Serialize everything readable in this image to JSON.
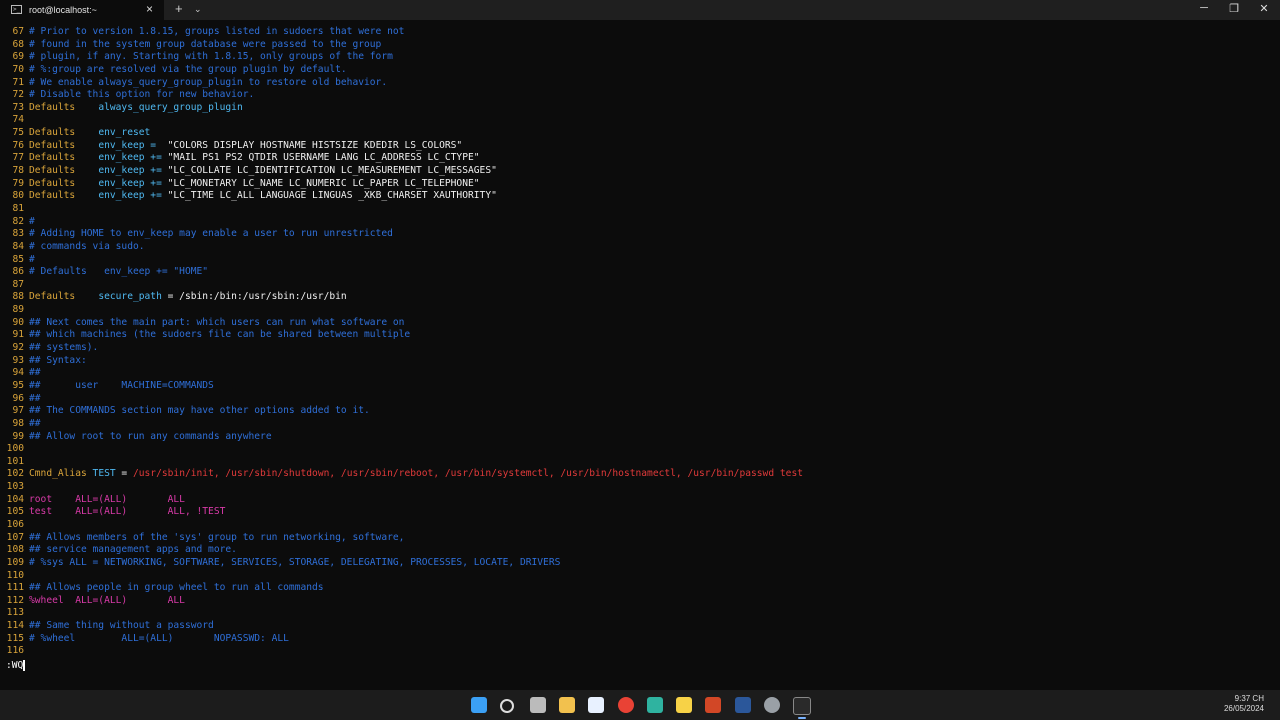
{
  "window": {
    "tab_title": "root@localhost:~",
    "tab_icon_glyph": ">_",
    "close_glyph": "×",
    "new_tab_glyph": "+",
    "dropdown_glyph": "⌄",
    "minimize_glyph": "─",
    "maximize_glyph": "❐",
    "window_close_glyph": "✕"
  },
  "colors": {
    "line_number": "#d9a43a",
    "comment": "#2f6fd8",
    "keyword": "#d9a43a",
    "identifier": "#4fb8f0",
    "string": "#f0f0f0",
    "constant": "#d83aa8",
    "alias_value": "#e03a3a",
    "default_text": "#f0f0f0"
  },
  "editor": {
    "lines": [
      {
        "n": "67",
        "segs": [
          {
            "t": "# Prior to version 1.8.15, groups listed in sudoers that were not",
            "c": "comment"
          }
        ]
      },
      {
        "n": "68",
        "segs": [
          {
            "t": "# found in the system group database were passed to the group",
            "c": "comment"
          }
        ]
      },
      {
        "n": "69",
        "segs": [
          {
            "t": "# plugin, if any. Starting with 1.8.15, only groups of the form",
            "c": "comment"
          }
        ]
      },
      {
        "n": "70",
        "segs": [
          {
            "t": "# %:group are resolved via the group plugin by default.",
            "c": "comment"
          }
        ]
      },
      {
        "n": "71",
        "segs": [
          {
            "t": "# We enable always_query_group_plugin to restore old behavior.",
            "c": "comment"
          }
        ]
      },
      {
        "n": "72",
        "segs": [
          {
            "t": "# Disable this option for new behavior.",
            "c": "comment"
          }
        ]
      },
      {
        "n": "73",
        "segs": [
          {
            "t": "Defaults",
            "c": "keyword"
          },
          {
            "t": "    always_query_group_plugin",
            "c": "identifier"
          }
        ]
      },
      {
        "n": "74",
        "segs": []
      },
      {
        "n": "75",
        "segs": [
          {
            "t": "Defaults",
            "c": "keyword"
          },
          {
            "t": "    env_reset",
            "c": "identifier"
          }
        ]
      },
      {
        "n": "76",
        "segs": [
          {
            "t": "Defaults",
            "c": "keyword"
          },
          {
            "t": "    env_keep =  ",
            "c": "identifier"
          },
          {
            "t": "\"COLORS DISPLAY HOSTNAME HISTSIZE KDEDIR LS_COLORS\"",
            "c": "string"
          }
        ]
      },
      {
        "n": "77",
        "segs": [
          {
            "t": "Defaults",
            "c": "keyword"
          },
          {
            "t": "    env_keep += ",
            "c": "identifier"
          },
          {
            "t": "\"MAIL PS1 PS2 QTDIR USERNAME LANG LC_ADDRESS LC_CTYPE\"",
            "c": "string"
          }
        ]
      },
      {
        "n": "78",
        "segs": [
          {
            "t": "Defaults",
            "c": "keyword"
          },
          {
            "t": "    env_keep += ",
            "c": "identifier"
          },
          {
            "t": "\"LC_COLLATE LC_IDENTIFICATION LC_MEASUREMENT LC_MESSAGES\"",
            "c": "string"
          }
        ]
      },
      {
        "n": "79",
        "segs": [
          {
            "t": "Defaults",
            "c": "keyword"
          },
          {
            "t": "    env_keep += ",
            "c": "identifier"
          },
          {
            "t": "\"LC_MONETARY LC_NAME LC_NUMERIC LC_PAPER LC_TELEPHONE\"",
            "c": "string"
          }
        ]
      },
      {
        "n": "80",
        "segs": [
          {
            "t": "Defaults",
            "c": "keyword"
          },
          {
            "t": "    env_keep += ",
            "c": "identifier"
          },
          {
            "t": "\"LC_TIME LC_ALL LANGUAGE LINGUAS _XKB_CHARSET XAUTHORITY\"",
            "c": "string"
          }
        ]
      },
      {
        "n": "81",
        "segs": []
      },
      {
        "n": "82",
        "segs": [
          {
            "t": "#",
            "c": "comment"
          }
        ]
      },
      {
        "n": "83",
        "segs": [
          {
            "t": "# Adding HOME to env_keep may enable a user to run unrestricted",
            "c": "comment"
          }
        ]
      },
      {
        "n": "84",
        "segs": [
          {
            "t": "# commands via sudo.",
            "c": "comment"
          }
        ]
      },
      {
        "n": "85",
        "segs": [
          {
            "t": "#",
            "c": "comment"
          }
        ]
      },
      {
        "n": "86",
        "segs": [
          {
            "t": "# Defaults   env_keep += \"HOME\"",
            "c": "comment"
          }
        ]
      },
      {
        "n": "87",
        "segs": []
      },
      {
        "n": "88",
        "segs": [
          {
            "t": "Defaults",
            "c": "keyword"
          },
          {
            "t": "    secure_path",
            "c": "identifier"
          },
          {
            "t": " = /sbin:/bin:/usr/sbin:/usr/bin",
            "c": "string"
          }
        ]
      },
      {
        "n": "89",
        "segs": []
      },
      {
        "n": "90",
        "segs": [
          {
            "t": "## Next comes the main part: which users can run what software on",
            "c": "comment"
          }
        ]
      },
      {
        "n": "91",
        "segs": [
          {
            "t": "## which machines (the sudoers file can be shared between multiple",
            "c": "comment"
          }
        ]
      },
      {
        "n": "92",
        "segs": [
          {
            "t": "## systems).",
            "c": "comment"
          }
        ]
      },
      {
        "n": "93",
        "segs": [
          {
            "t": "## Syntax:",
            "c": "comment"
          }
        ]
      },
      {
        "n": "94",
        "segs": [
          {
            "t": "##",
            "c": "comment"
          }
        ]
      },
      {
        "n": "95",
        "segs": [
          {
            "t": "##      user    MACHINE=COMMANDS",
            "c": "comment"
          }
        ]
      },
      {
        "n": "96",
        "segs": [
          {
            "t": "##",
            "c": "comment"
          }
        ]
      },
      {
        "n": "97",
        "segs": [
          {
            "t": "## The COMMANDS section may have other options added to it.",
            "c": "comment"
          }
        ]
      },
      {
        "n": "98",
        "segs": [
          {
            "t": "##",
            "c": "comment"
          }
        ]
      },
      {
        "n": "99",
        "segs": [
          {
            "t": "## Allow root to run any commands anywhere",
            "c": "comment"
          }
        ]
      },
      {
        "n": "100",
        "segs": []
      },
      {
        "n": "101",
        "segs": []
      },
      {
        "n": "102",
        "segs": [
          {
            "t": "Cmnd_Alias",
            "c": "keyword"
          },
          {
            "t": " TEST",
            "c": "identifier"
          },
          {
            "t": " = ",
            "c": "string"
          },
          {
            "t": "/usr/sbin/init, /usr/sbin/shutdown, /usr/sbin/reboot, /usr/bin/systemctl, /usr/bin/hostnamectl, /usr/bin/passwd test",
            "c": "alias_value"
          }
        ]
      },
      {
        "n": "103",
        "segs": []
      },
      {
        "n": "104",
        "segs": [
          {
            "t": "root    ALL=(ALL)       ALL",
            "c": "constant"
          }
        ]
      },
      {
        "n": "105",
        "segs": [
          {
            "t": "test    ALL=(ALL)       ALL, !TEST",
            "c": "constant"
          }
        ]
      },
      {
        "n": "106",
        "segs": []
      },
      {
        "n": "107",
        "segs": [
          {
            "t": "## Allows members of the 'sys' group to run networking, software,",
            "c": "comment"
          }
        ]
      },
      {
        "n": "108",
        "segs": [
          {
            "t": "## service management apps and more.",
            "c": "comment"
          }
        ]
      },
      {
        "n": "109",
        "segs": [
          {
            "t": "# %sys ALL = NETWORKING, SOFTWARE, SERVICES, STORAGE, DELEGATING, PROCESSES, LOCATE, DRIVERS",
            "c": "comment"
          }
        ]
      },
      {
        "n": "110",
        "segs": []
      },
      {
        "n": "111",
        "segs": [
          {
            "t": "## Allows people in group wheel to run all commands",
            "c": "comment"
          }
        ]
      },
      {
        "n": "112",
        "segs": [
          {
            "t": "%wheel  ALL=(ALL)       ALL",
            "c": "constant"
          }
        ]
      },
      {
        "n": "113",
        "segs": []
      },
      {
        "n": "114",
        "segs": [
          {
            "t": "## Same thing without a password",
            "c": "comment"
          }
        ]
      },
      {
        "n": "115",
        "segs": [
          {
            "t": "# %wheel        ALL=(ALL)       NOPASSWD: ALL",
            "c": "comment"
          }
        ]
      },
      {
        "n": "116",
        "segs": []
      }
    ],
    "command_line": ":WQ"
  },
  "taskbar": {
    "icons": [
      {
        "name": "start-icon",
        "color": "#3ba0f5"
      },
      {
        "name": "search-icon",
        "color": "#dddddd"
      },
      {
        "name": "task-view-icon",
        "color": "#bbbbbb"
      },
      {
        "name": "file-explorer-icon",
        "color": "#f2c14e"
      },
      {
        "name": "zalo-icon",
        "color": "#e8f1ff"
      },
      {
        "name": "chrome-icon",
        "color": "#e94235"
      },
      {
        "name": "screen-capture-icon",
        "color": "#2fb3a0"
      },
      {
        "name": "sticky-notes-icon",
        "color": "#f7d247"
      },
      {
        "name": "powerpoint-icon",
        "color": "#d24726"
      },
      {
        "name": "word-icon",
        "color": "#2b579a"
      },
      {
        "name": "settings-icon",
        "color": "#9aa0a6"
      },
      {
        "name": "terminal-icon",
        "color": "#2a2a2a"
      }
    ],
    "time": "9:37 CH",
    "date": "26/05/2024"
  }
}
